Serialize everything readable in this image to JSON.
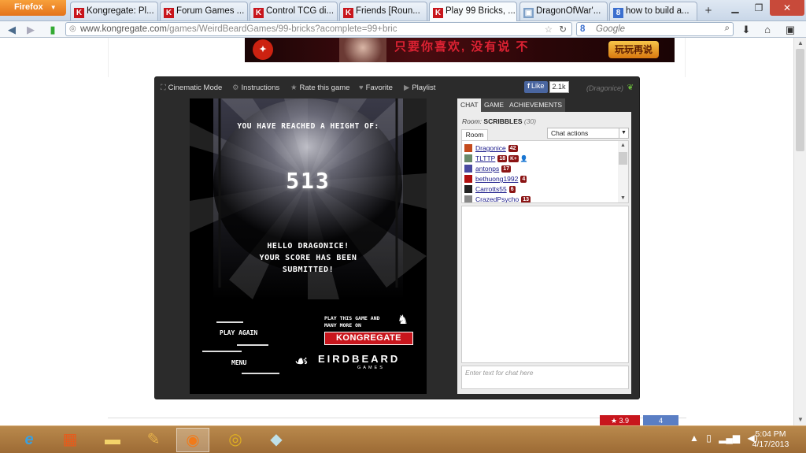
{
  "browser": {
    "menu_label": "Firefox",
    "tabs": [
      {
        "title": "Kongregate: Pl...",
        "favicon": "K",
        "active": false
      },
      {
        "title": "Forum Games ...",
        "favicon": "K",
        "active": false
      },
      {
        "title": "Control TCG di...",
        "favicon": "K",
        "active": false
      },
      {
        "title": "Friends [Roun...",
        "favicon": "K",
        "active": false
      },
      {
        "title": "Play 99 Bricks, ...",
        "favicon": "K",
        "active": true
      },
      {
        "title": "DragonOfWar'...",
        "favicon": "image",
        "active": false
      },
      {
        "title": "how to build a...",
        "favicon": "8",
        "active": false
      }
    ],
    "new_tab": "+",
    "url_host": "www.kongregate.com",
    "url_path": "/games/WeirdBeardGames/99-bricks?acomplete=99+bric",
    "search_placeholder": "Google"
  },
  "banner": {
    "chinese_text": "只要你喜欢, 没有说 不",
    "button_label": "玩玩再说"
  },
  "game_toolbar": {
    "cinematic": "Cinematic Mode",
    "instructions": "Instructions",
    "rate": "Rate this game",
    "favorite": "Favorite",
    "playlist": "Playlist",
    "fb_like": "Like",
    "fb_count": "2.1k",
    "user": "(Dragonice)"
  },
  "game": {
    "height_text": "YOU HAVE REACHED A HEIGHT OF:",
    "score": "513",
    "msg_line1": "HELLO DRAGONICE!",
    "msg_line2": "YOUR SCORE HAS BEEN",
    "msg_line3": "SUBMITTED!",
    "play_again": "PLAY AGAIN",
    "menu": "MENU",
    "promo_line1": "PLAY THIS GAME AND",
    "promo_line2": "MANY MORE ON",
    "promo_brand": "KONGREGATE",
    "studio_name": "EIRDBEARD",
    "studio_sub": "GAMES"
  },
  "chat": {
    "tabs": [
      "CHAT",
      "GAME",
      "ACHIEVEMENTS"
    ],
    "room_label": "Room:",
    "room_name": "SCRIBBLES",
    "room_count": "(30)",
    "room_tab": "Room",
    "actions_label": "Chat actions",
    "input_placeholder": "Enter text for chat here",
    "users": [
      {
        "name": "Dragonice",
        "level": "42",
        "avatar_color": "#c44a1c"
      },
      {
        "name": "TLTTP",
        "level": "18",
        "kplus": "K+",
        "avatar_color": "#6a8a6a"
      },
      {
        "name": "antonps",
        "level": "17",
        "avatar_color": "#4a4aa0"
      },
      {
        "name": "bethuong1992",
        "level": "4",
        "avatar_color": "#b01010"
      },
      {
        "name": "Carrotts55",
        "level": "6",
        "avatar_color": "#222222"
      },
      {
        "name": "CrazedPsycho",
        "level": "13",
        "avatar_color": "#888888"
      }
    ]
  },
  "share": {
    "red_label": "★ 3.9",
    "blue_label": "4"
  },
  "taskbar": {
    "time": "5:04 PM",
    "date": "4/17/2013"
  }
}
